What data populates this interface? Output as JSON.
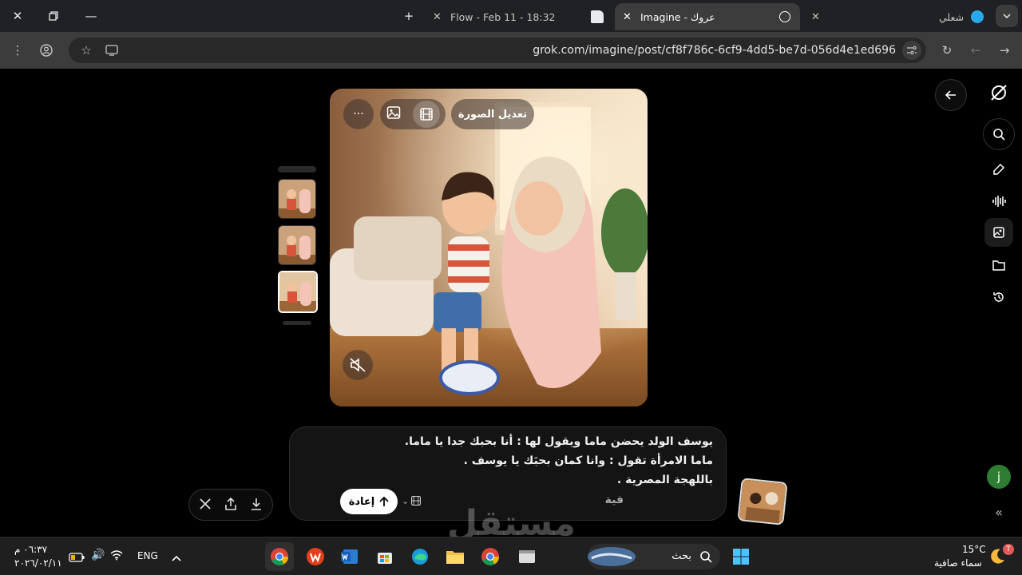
{
  "browser": {
    "tabs": [
      {
        "label": "عروك - Imagine",
        "active": true
      },
      {
        "label": "Flow - Feb 11 - 18:32",
        "active": false
      },
      {
        "label": "شعلي",
        "active": false
      }
    ],
    "url": "grok.com/imagine/post/cf8f786c-6cf9-4dd5-be7d-056d4e1ed696",
    "new_tab": "+"
  },
  "image_view": {
    "edit_label": "تعديل الصورة",
    "more_label": "···"
  },
  "prompt": {
    "lines": [
      "يوسف الولد يحضن ماما ويقول لها  : أنا بحبك جدا يا ماما.",
      "ماما الامرأة تقول : وانا كمان بحبَك يا يوسف .",
      "باللهجة المصرية .",
      "فية"
    ],
    "retry_label": "إعادة"
  },
  "user": {
    "avatar_letter": "j"
  },
  "taskbar": {
    "search_placeholder": "بحث",
    "language": "ENG",
    "time": "٠٦:٣٧ م",
    "date": "٢٠٢٦/٠٢/١١",
    "weather_temp": "15°C",
    "weather_desc": "سماء صافية",
    "notif_badge": "T"
  },
  "watermark": "مستقل",
  "colors": {
    "chrome_bg": "#202124",
    "toolbar_bg": "#3c3c3c",
    "page_bg": "#000000",
    "avatar_green": "#2e7d32"
  }
}
